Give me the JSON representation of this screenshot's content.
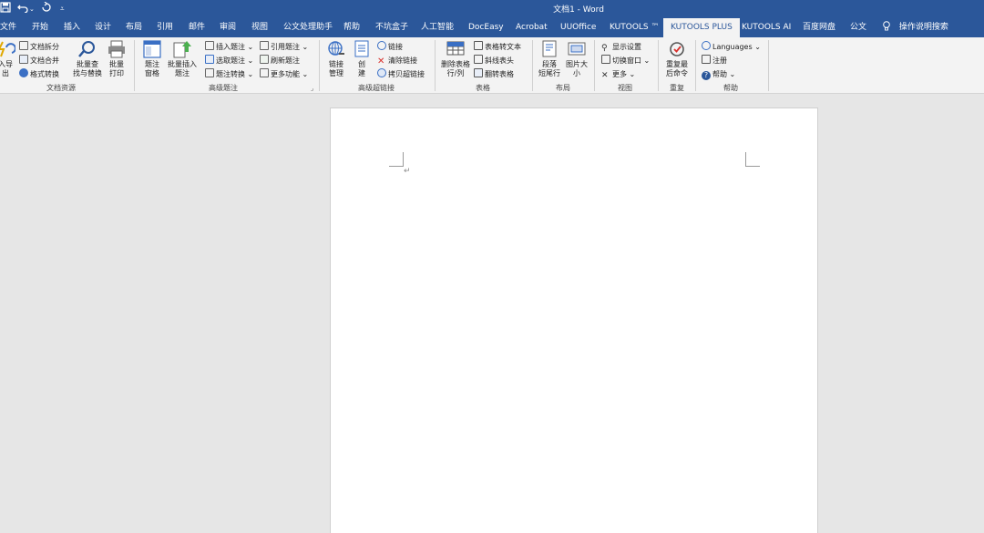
{
  "title_bar": {
    "save_icon": "save-icon",
    "undo_icon": "undo-icon",
    "redo_icon": "redo-icon",
    "customize_icon": "customize-quick-access-icon",
    "document_title": "文档1  -  Word"
  },
  "tabs": [
    {
      "label": "文件"
    },
    {
      "label": "开始"
    },
    {
      "label": "插入"
    },
    {
      "label": "设计"
    },
    {
      "label": "布局"
    },
    {
      "label": "引用"
    },
    {
      "label": "邮件"
    },
    {
      "label": "审阅"
    },
    {
      "label": "视图"
    },
    {
      "label": "公文处理助手"
    },
    {
      "label": "帮助"
    },
    {
      "label": "不坑盒子"
    },
    {
      "label": "人工智能"
    },
    {
      "label": "DocEasy"
    },
    {
      "label": "Acrobat"
    },
    {
      "label": "UUOffice"
    },
    {
      "label": "KUTOOLS ™"
    },
    {
      "label": "KUTOOLS PLUS",
      "active": true
    },
    {
      "label": "KUTOOLS AI"
    },
    {
      "label": "百度网盘"
    },
    {
      "label": "公文"
    }
  ],
  "tell_me": {
    "label": "操作说明搜索",
    "icon": "lightbulb-icon"
  },
  "ribbon": {
    "groups": {
      "doc_resources": {
        "label": "文档资源",
        "import_export": "入导\n出",
        "split_doc": "文档拆分",
        "merge_doc": "文档合并",
        "format_convert": "格式转换",
        "batch_find": "批量查\n找与替换",
        "batch_print": "批量\n打印"
      },
      "advanced_caption": {
        "label": "高级题注",
        "caption_pane": "题注\n窗格",
        "batch_insert_caption": "批量插入\n题注",
        "insert_caption": "插入题注",
        "select_caption": "选取题注",
        "caption_convert": "题注转换",
        "cite_caption": "引用题注",
        "refresh_caption": "刷新题注",
        "more_features": "更多功能"
      },
      "advanced_hyperlink": {
        "label": "高级超链接",
        "link_manage": "链接\n管理",
        "create": "创\n建",
        "link": "链接",
        "clear_link": "清除链接",
        "copy_hyperlink": "拷贝超链接"
      },
      "table": {
        "label": "表格",
        "delete_rows_cols": "删除表格\n行/列",
        "table_to_text": "表格转文本",
        "diagonal_header": "斜线表头",
        "flip_table": "翻转表格"
      },
      "layout": {
        "label": "布局",
        "paragraph_tail": "段落\n短尾行",
        "image_size": "图片大\n小"
      },
      "view": {
        "label": "视图",
        "show_settings": "显示设置",
        "switch_window": "切换窗口",
        "more": "更多"
      },
      "repeat": {
        "label": "重复",
        "repeat_last": "重复最\n后命令"
      },
      "help": {
        "label": "帮助",
        "languages": "Languages",
        "register": "注册",
        "help": "帮助"
      }
    }
  },
  "document": {
    "paragraph_mark": "↵"
  }
}
